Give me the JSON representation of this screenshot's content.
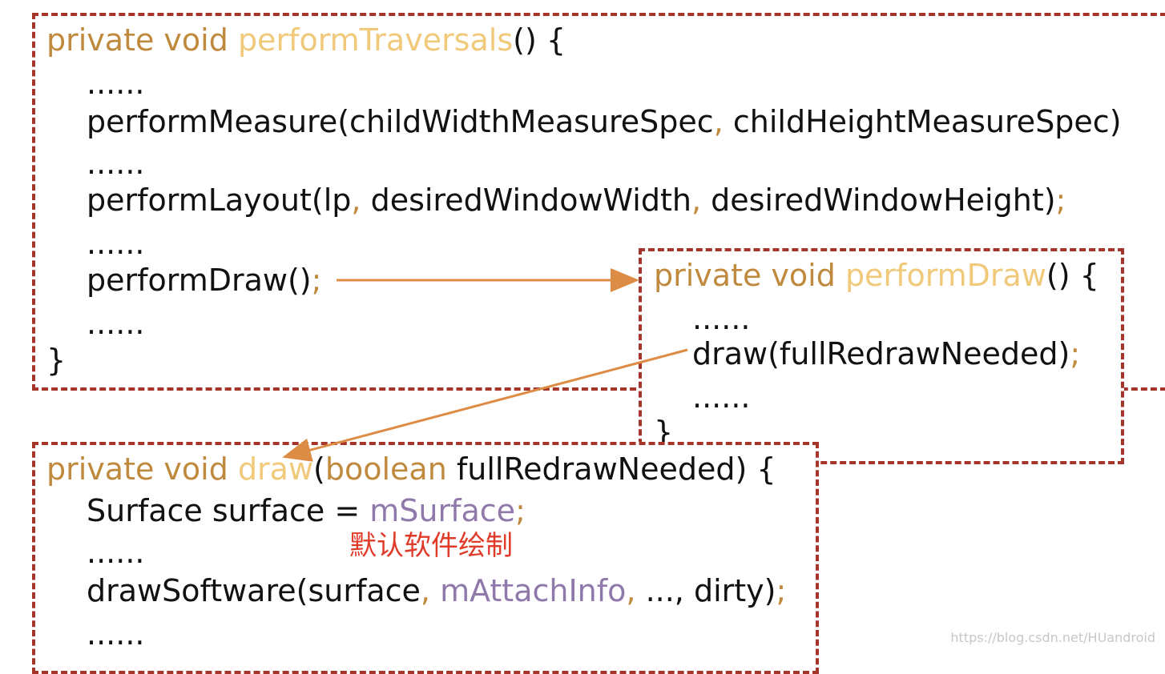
{
  "box_traversals": {
    "sig": {
      "kw": "private void ",
      "fn": "performTraversals",
      "rest": "() {"
    },
    "lines": [
      "......",
      "performMeasure(childWidthMeasureSpec",
      ", ",
      "childHeightMeasureSpec)",
      "......",
      "performLayout(lp",
      ", ",
      "desiredWindowWidth",
      ", ",
      "desiredWindowHeight)",
      ";",
      "......",
      "performDraw()",
      ";",
      "......"
    ],
    "close": "}"
  },
  "box_perform_draw": {
    "sig": {
      "kw": "private void ",
      "fn": "performDraw",
      "rest": "() {"
    },
    "l1": "......",
    "l2_call": "draw(fullRedrawNeeded)",
    "l2_semi": ";",
    "l3": "......",
    "close": "}"
  },
  "box_draw": {
    "sig": {
      "kw": "private void ",
      "fn": "draw",
      "paren": "(",
      "type": "boolean",
      "rest": " fullRedrawNeeded) {"
    },
    "l1_a": "Surface surface = ",
    "l1_field": "mSurface",
    "l1_semi": ";",
    "note": "默认软件绘制",
    "l2": "......",
    "l3_a": "drawSoftware(surface",
    "l3_comma": ", ",
    "l3_field": "mAttachInfo",
    "l3_comma2": ", ",
    "l3_b": "..., dirty)",
    "l3_semi": ";",
    "l4": "......"
  },
  "colors": {
    "keyword": "#c08a3e",
    "function": "#f0c97a",
    "field": "#8f79ab",
    "dash": "#a5342a",
    "arrow": "#dd8c45",
    "note": "#e03a28"
  },
  "watermark": "https://blog.csdn.net/HUandroid"
}
